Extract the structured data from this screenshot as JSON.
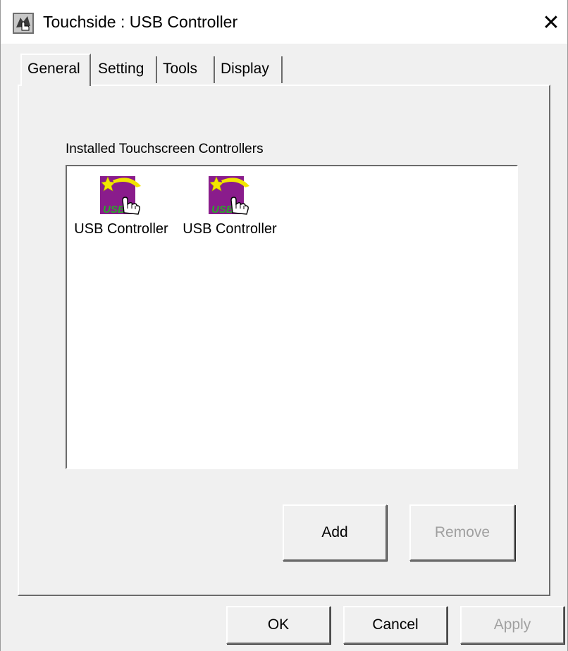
{
  "window": {
    "title": "Touchside : USB Controller",
    "close_glyph": "✕"
  },
  "tabs": [
    {
      "label": "General",
      "active": true
    },
    {
      "label": "Setting",
      "active": false
    },
    {
      "label": "Tools",
      "active": false
    },
    {
      "label": "Display",
      "active": false
    }
  ],
  "general": {
    "group_label": "Installed Touchscreen Controllers",
    "controllers": [
      {
        "label": "USB Controller",
        "icon": "usb-touch-controller-icon",
        "badge": "USB"
      },
      {
        "label": "USB Controller",
        "icon": "usb-touch-controller-icon",
        "badge": "USB"
      }
    ],
    "buttons": {
      "add": "Add",
      "remove": "Remove",
      "remove_enabled": false
    }
  },
  "footer": {
    "ok": "OK",
    "cancel": "Cancel",
    "apply": "Apply",
    "apply_enabled": false
  },
  "colors": {
    "dialog_background": "#f0f0f0",
    "disabled_text": "#a0a0a0",
    "icon_purple": "#8a1c8c",
    "icon_star_yellow": "#f2e600",
    "icon_badge_green": "#2aa82a"
  }
}
